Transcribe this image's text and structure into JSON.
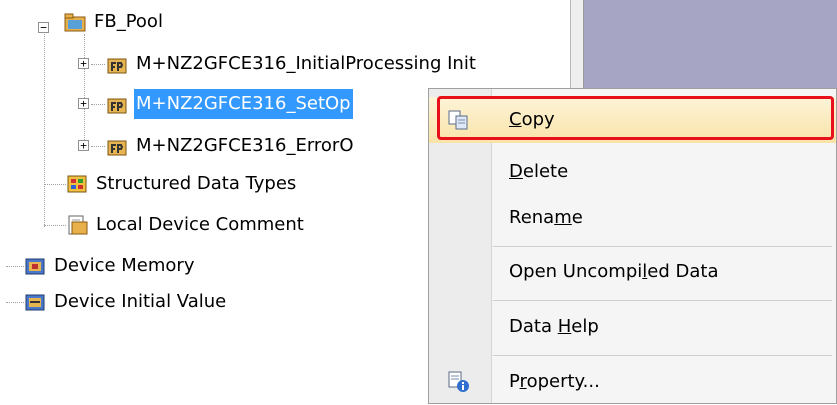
{
  "tree": {
    "fb_pool": "FB_Pool",
    "fb1": "M+NZ2GFCE316_InitialProcessing Init",
    "fb2": "M+NZ2GFCE316_SetOp",
    "fb3": "M+NZ2GFCE316_ErrorO",
    "structured": "Structured Data Types",
    "local_comment": "Local Device Comment",
    "device_memory": "Device Memory",
    "device_initial": "Device Initial Value"
  },
  "menu": {
    "copy_pre": "",
    "copy_u": "C",
    "copy_post": "opy",
    "delete_pre": "",
    "delete_u": "D",
    "delete_post": "elete",
    "rename_pre": "Rena",
    "rename_u": "m",
    "rename_post": "e",
    "open_pre": "Open Uncompi",
    "open_u": "l",
    "open_post": "ed Data",
    "help_pre": "Data ",
    "help_u": "H",
    "help_post": "elp",
    "prop_pre": "P",
    "prop_u": "r",
    "prop_post": "operty..."
  },
  "colors": {
    "selection": "#3399ff",
    "highlight_border": "#e8101a",
    "right_pane": "#a6a6c4"
  }
}
